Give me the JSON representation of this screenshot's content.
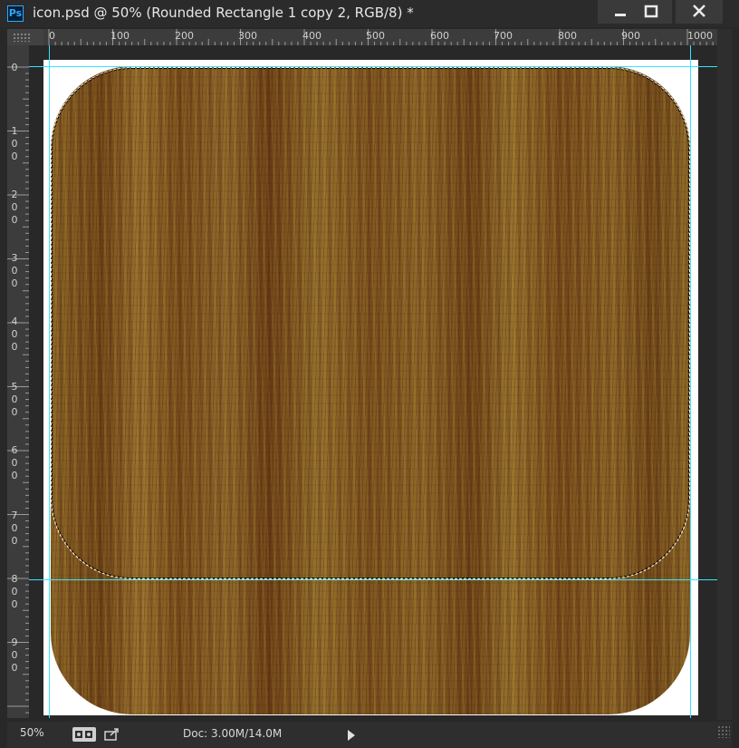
{
  "window": {
    "app_icon_text": "Ps",
    "title": "icon.psd @ 50% (Rounded Rectangle 1 copy 2, RGB/8) *",
    "controls": {
      "minimize_icon": "minimize-icon",
      "maximize_icon": "maximize-icon",
      "close_icon": "close-icon"
    }
  },
  "rulers": {
    "horizontal": [
      "0",
      "100",
      "200",
      "300",
      "400",
      "500",
      "600",
      "700",
      "800",
      "900",
      "1000"
    ],
    "vertical": [
      "0",
      "100",
      "200",
      "300",
      "400",
      "500",
      "600",
      "700",
      "800",
      "900"
    ]
  },
  "status": {
    "zoom": "50%",
    "doc_size": "Doc: 3.00M/14.0M"
  },
  "colors": {
    "guide": "#36e6ff",
    "wood_light": "#9a7230",
    "wood_dark": "#6a3e16"
  }
}
